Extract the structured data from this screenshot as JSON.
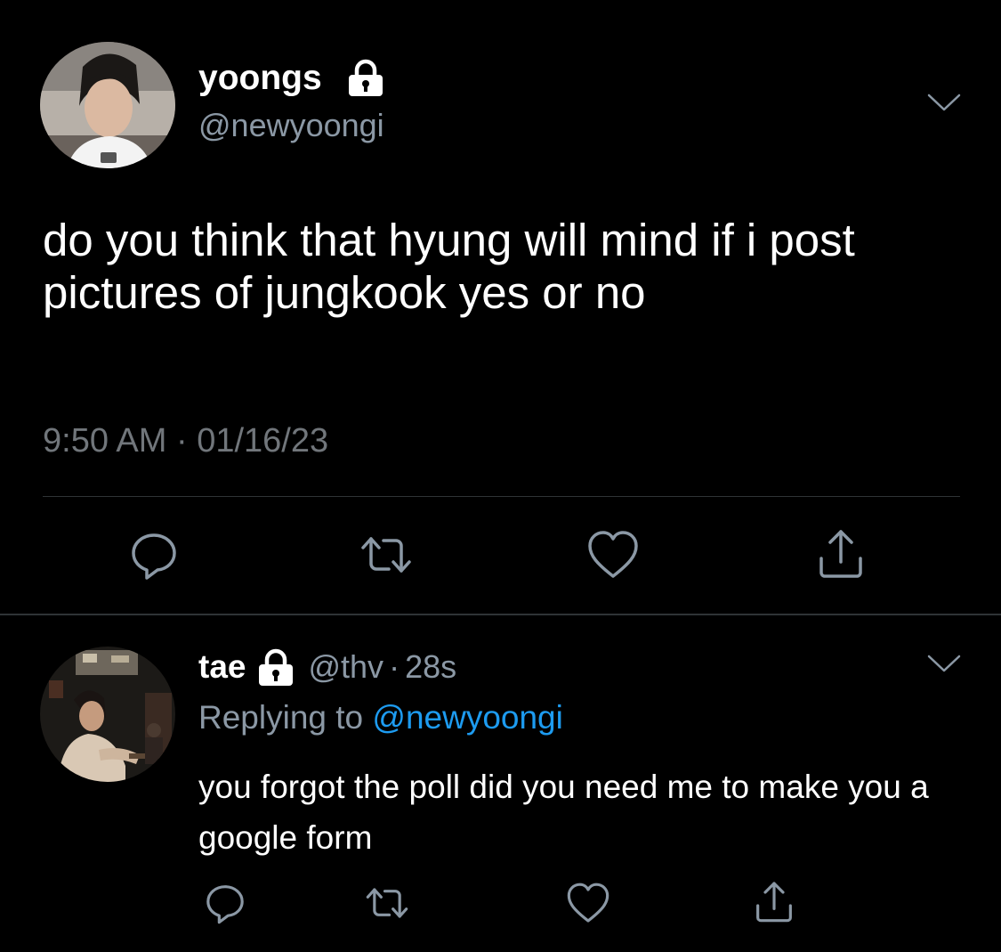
{
  "main_tweet": {
    "avatar_icon": "user-avatar-photo",
    "display_name": "yoongs",
    "protected_icon": "lock-icon",
    "handle": "@newyoongi",
    "text": "do you think that hyung will mind if i post pictures of jungkook yes or no",
    "timestamp": "9:50 AM · 01/16/23",
    "more_icon": "chevron-down-icon",
    "actions": [
      {
        "name": "reply",
        "icon": "reply-icon"
      },
      {
        "name": "retweet",
        "icon": "retweet-icon"
      },
      {
        "name": "like",
        "icon": "heart-icon"
      },
      {
        "name": "share",
        "icon": "share-icon"
      }
    ]
  },
  "reply_tweet": {
    "avatar_icon": "user-avatar-photo",
    "display_name": "tae",
    "protected_icon": "lock-icon",
    "handle": "@thv",
    "separator": "·",
    "age": "28s",
    "replying_prefix": "Replying to",
    "replying_mention": "@newyoongi",
    "text": "you forgot the poll did you need me to make you a google form",
    "more_icon": "chevron-down-icon"
  },
  "colors": {
    "background": "#000000",
    "primary_text": "#ffffff",
    "secondary_text": "#8b98a5",
    "timestamp_text": "#71767b",
    "link": "#1d9bf0",
    "icon": "#8b98a5",
    "divider": "#2f3336"
  }
}
